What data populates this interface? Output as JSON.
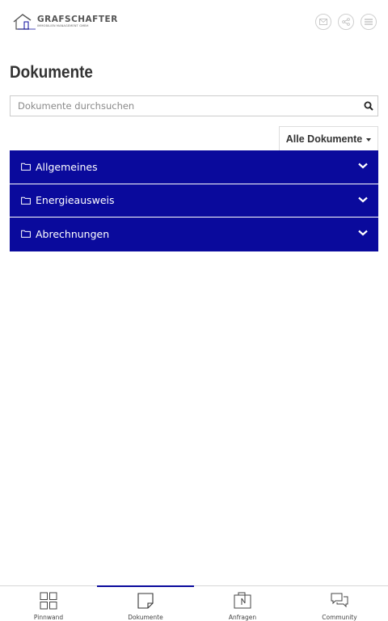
{
  "header": {
    "logo_title": "GRAFSCHAFTER",
    "logo_subtitle": "IMMOBILIEN MANAGEMENT GMBH",
    "buttons": [
      {
        "icon": "mail-icon"
      },
      {
        "icon": "share-icon"
      },
      {
        "icon": "menu-icon"
      }
    ]
  },
  "page": {
    "title": "Dokumente"
  },
  "search": {
    "placeholder": "Dokumente durchsuchen",
    "value": ""
  },
  "filter": {
    "label": "Alle Dokumente"
  },
  "folders": [
    {
      "label": "Allgemeines"
    },
    {
      "label": "Energieausweis"
    },
    {
      "label": "Abrechnungen"
    }
  ],
  "nav": {
    "items": [
      {
        "label": "Pinnwand",
        "icon": "grid-icon",
        "active": false
      },
      {
        "label": "Dokumente",
        "icon": "document-icon",
        "active": true
      },
      {
        "label": "Anfragen",
        "icon": "requests-icon",
        "active": false
      },
      {
        "label": "Community",
        "icon": "chat-icon",
        "active": false
      }
    ]
  },
  "colors": {
    "accent": "#0a0a9c",
    "text": "#333333",
    "border": "#cccccc"
  }
}
